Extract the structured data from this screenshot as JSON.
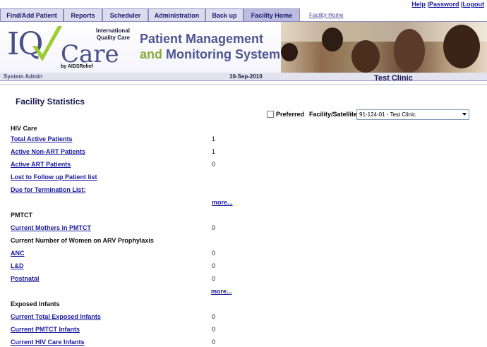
{
  "top_links": {
    "help": "Help",
    "sep1": " |",
    "password": "Password",
    "sep2": " |",
    "logout": "Logout"
  },
  "tabs": [
    {
      "label": "Find/Add Patient"
    },
    {
      "label": "Reports"
    },
    {
      "label": "Scheduler"
    },
    {
      "label": "Administration"
    },
    {
      "label": "Back up"
    },
    {
      "label": "Facility Home"
    }
  ],
  "facility_home_link": "Facility Home",
  "banner": {
    "logo_iq": "IQ",
    "logo_care": "Care",
    "logo_intl_line1": "International",
    "logo_intl_line2": "Quality Care",
    "logo_by": "by AIDSRelief",
    "title_line1": "Patient Management",
    "title_and": "and ",
    "title_line2": "Monitoring System"
  },
  "system_bar": {
    "user": "System Admin",
    "date": "10-Sep-2010",
    "clinic": "Test Clinic"
  },
  "page_title": "Facility Statistics",
  "filters": {
    "preferred_label": "Preferred",
    "facility_label": "Facility/Satellite",
    "facility_value": "91-124-01 - Test Clinic"
  },
  "sections": {
    "hiv_care": {
      "heading": "HIV Care",
      "items": [
        {
          "label": "Total Active Patients",
          "value": "1"
        },
        {
          "label": "Active Non-ART Patients",
          "value": "1"
        },
        {
          "label": "Active ART Patients",
          "value": "0"
        },
        {
          "label": "Lost to Follow up Patient list",
          "value": ""
        },
        {
          "label": "Due for Termination List:",
          "value": ""
        }
      ],
      "more": "more..."
    },
    "pmtct": {
      "heading": "PMTCT",
      "items": [
        {
          "label": "Current Mothers in PMTCT",
          "value": "0"
        }
      ],
      "subheading": "Current Number of Women on ARV Prophylaxis",
      "sub_items": [
        {
          "label": "ANC",
          "value": "0"
        },
        {
          "label": "L&D",
          "value": "0"
        },
        {
          "label": "Postnatal",
          "value": "0"
        }
      ],
      "more": "more..."
    },
    "exposed_infants": {
      "heading": "Exposed Infants",
      "items": [
        {
          "label": "Current Total Exposed Infants",
          "value": "0"
        },
        {
          "label": "Current PMTCT Infants",
          "value": "0"
        },
        {
          "label": "Current HIV Care Infants",
          "value": "0"
        }
      ]
    }
  }
}
